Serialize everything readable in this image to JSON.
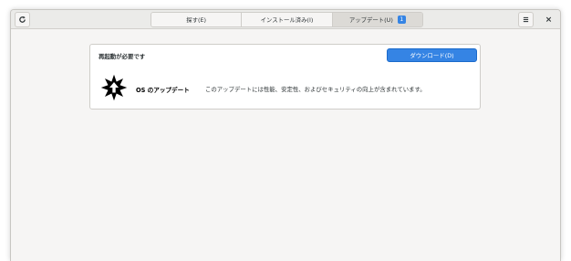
{
  "header": {
    "refresh_icon": "refresh-icon",
    "menu_icon": "hamburger-menu-icon",
    "close_label": "×",
    "tabs": [
      {
        "label": "探す(E)",
        "active": false
      },
      {
        "label": "インストール済み(I)",
        "active": false
      },
      {
        "label": "アップデート(U)",
        "active": true,
        "badge": "1"
      }
    ]
  },
  "updates": {
    "card_title": "再起動が必要です",
    "download_button": "ダウンロード(D)",
    "os_update": {
      "icon": "os-update-icon",
      "title": "OS のアップデート",
      "description": "このアップデートには性能、安定性、およびセキュリティの向上が含まれています。"
    }
  },
  "colors": {
    "accent": "#3584e4",
    "window_bg": "#f6f5f4",
    "headerbar_bg": "#ebebe9"
  }
}
